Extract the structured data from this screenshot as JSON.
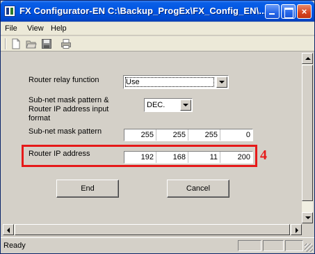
{
  "window": {
    "title": "FX Configurator-EN C:\\Backup_ProgEx\\FX_Config_EN\\...",
    "controls": {
      "minimize": "",
      "maximize": "",
      "close": "×"
    }
  },
  "menu": {
    "items": [
      "File",
      "View",
      "Help"
    ]
  },
  "toolbar": {
    "icons": [
      "new-file-icon",
      "open-folder-icon",
      "save-icon",
      "print-icon"
    ]
  },
  "form": {
    "router_relay_label": "Router relay function",
    "router_relay_value": "Use",
    "format_label": "Sub-net mask pattern &\nRouter IP address input format",
    "format_value": "DEC.",
    "subnet_label": "Sub-net mask pattern",
    "subnet_octets": [
      "255",
      "255",
      "255",
      "0"
    ],
    "router_ip_label": "Router IP address",
    "router_ip_octets": [
      "192",
      "168",
      "11",
      "200"
    ]
  },
  "buttons": {
    "end": "End",
    "cancel": "Cancel"
  },
  "annotation": {
    "callout_number": "4",
    "color": "#e61919"
  },
  "status": {
    "text": "Ready"
  }
}
